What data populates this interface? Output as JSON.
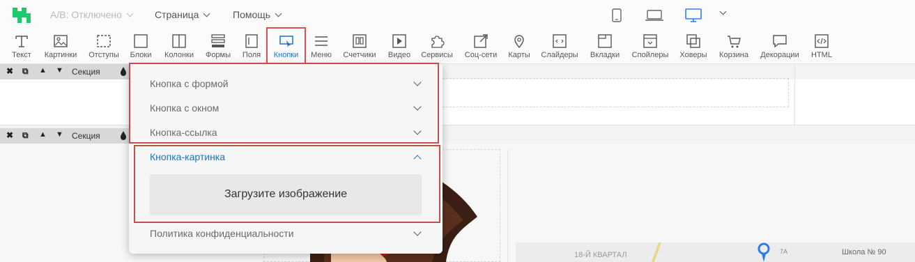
{
  "topbar": {
    "ab_label": "A/B: Отключено",
    "page_menu": "Страница",
    "help_menu": "Помощь"
  },
  "toolbar": {
    "items": [
      {
        "label": "Текст",
        "icon": "text-icon"
      },
      {
        "label": "Картинки",
        "icon": "image-icon"
      },
      {
        "label": "Отступы",
        "icon": "padding-icon"
      },
      {
        "label": "Блоки",
        "icon": "block-icon"
      },
      {
        "label": "Колонки",
        "icon": "columns-icon"
      },
      {
        "label": "Формы",
        "icon": "form-icon"
      },
      {
        "label": "Поля",
        "icon": "field-icon"
      },
      {
        "label": "Кнопки",
        "icon": "button-icon"
      },
      {
        "label": "Меню",
        "icon": "menu-icon"
      },
      {
        "label": "Счетчики",
        "icon": "counter-icon"
      },
      {
        "label": "Видео",
        "icon": "video-icon"
      },
      {
        "label": "Сервисы",
        "icon": "puzzle-icon"
      },
      {
        "label": "Соц-сети",
        "icon": "share-icon"
      },
      {
        "label": "Карты",
        "icon": "map-pin-icon"
      },
      {
        "label": "Слайдеры",
        "icon": "slider-icon"
      },
      {
        "label": "Вкладки",
        "icon": "tabs-icon"
      },
      {
        "label": "Спойлеры",
        "icon": "spoiler-icon"
      },
      {
        "label": "Ховеры",
        "icon": "hover-icon"
      },
      {
        "label": "Корзина",
        "icon": "cart-icon"
      },
      {
        "label": "Декорации",
        "icon": "speech-bubble-icon"
      },
      {
        "label": "HTML",
        "icon": "code-icon"
      }
    ],
    "active": "Кнопки"
  },
  "sections": [
    {
      "label": "Секция"
    },
    {
      "label": "Секция"
    }
  ],
  "dropdown": {
    "items": [
      {
        "label": "Кнопка с формой"
      },
      {
        "label": "Кнопка с окном"
      },
      {
        "label": "Кнопка-ссылка"
      },
      {
        "label": "Кнопка-картинка"
      },
      {
        "label": "Политика конфиденциальности"
      }
    ],
    "open_item": "Кнопка-картинка",
    "upload_label": "Загрузите изображение"
  },
  "map": {
    "labels": [
      "18-Й КВАРТАЛ",
      "Школа № 90",
      "7А"
    ]
  },
  "colors": {
    "brand": "#1ec86b",
    "accent": "#1e73be",
    "highlight": "#c0504d"
  }
}
